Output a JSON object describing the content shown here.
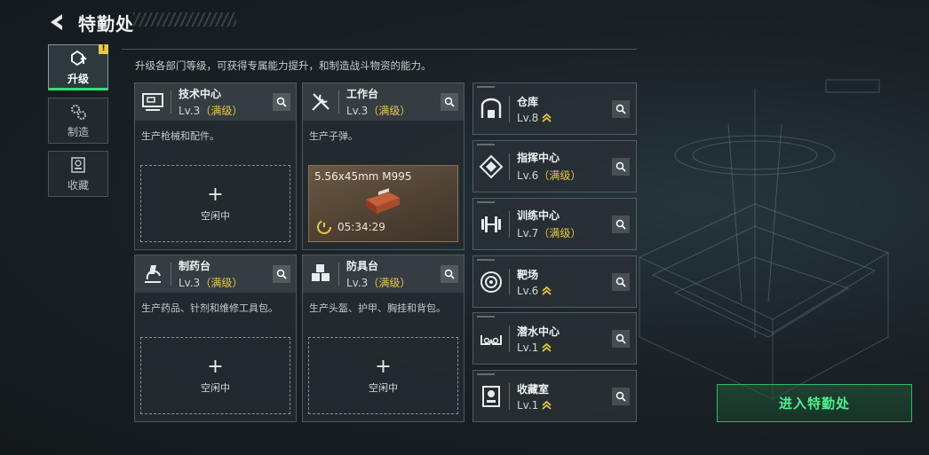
{
  "header": {
    "title": "特勤处"
  },
  "side_tabs": [
    {
      "label": "升级",
      "badge": "!",
      "active": true
    },
    {
      "label": "制造",
      "active": false
    },
    {
      "label": "收藏",
      "active": false
    }
  ],
  "description": "升级各部门等级，可获得专属能力提升，和制造战斗物资的能力。",
  "departments": [
    {
      "name": "技术中心",
      "level": "Lv.3",
      "max_tag": "（满级）",
      "desc": "生产枪械和配件。",
      "slot": "空闲中",
      "icon": "computer-icon"
    },
    {
      "name": "工作台",
      "level": "Lv.3",
      "max_tag": "（满级）",
      "desc": "生产子弹。",
      "craft_item": "5.56x45mm M995",
      "craft_timer": "05:34:29",
      "icon": "tools-icon"
    },
    {
      "name": "制药台",
      "level": "Lv.3",
      "max_tag": "（满级）",
      "desc": "生产药品、针剂和维修工具包。",
      "slot": "空闲中",
      "icon": "microscope-icon"
    },
    {
      "name": "防具台",
      "level": "Lv.3",
      "max_tag": "（满级）",
      "desc": "生产头盔、护甲、胸挂和背包。",
      "slot": "空闲中",
      "icon": "cubes-icon"
    }
  ],
  "facilities": [
    {
      "name": "仓库",
      "level": "Lv.8",
      "max_tag": "",
      "upgradable": true,
      "icon": "warehouse-icon"
    },
    {
      "name": "指挥中心",
      "level": "Lv.6",
      "max_tag": "（满级）",
      "upgradable": false,
      "icon": "command-icon"
    },
    {
      "name": "训练中心",
      "level": "Lv.7",
      "max_tag": "（满级）",
      "upgradable": false,
      "icon": "dumbbell-icon"
    },
    {
      "name": "靶场",
      "level": "Lv.6",
      "max_tag": "",
      "upgradable": true,
      "icon": "target-icon"
    },
    {
      "name": "潜水中心",
      "level": "Lv.1",
      "max_tag": "",
      "upgradable": true,
      "icon": "diving-mask-icon"
    },
    {
      "name": "收藏室",
      "level": "Lv.1",
      "max_tag": "",
      "upgradable": true,
      "icon": "trophy-case-icon"
    }
  ],
  "enter_button": {
    "label": "进入特勤处"
  },
  "colors": {
    "accent_green": "#4ff08e",
    "max_gold": "#e7c74a",
    "badge_yellow": "#e8c84a"
  }
}
